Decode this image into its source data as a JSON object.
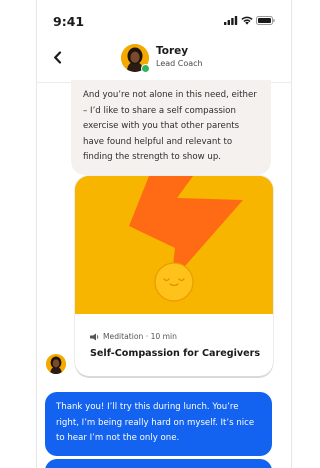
{
  "status_bar": {
    "time": "9:41"
  },
  "header": {
    "coach_name": "Torey",
    "coach_role": "Lead Coach"
  },
  "messages": {
    "incoming_text": "And you’re not alone in this need, either – I’d like to share a self compassion exercise with you that other parents have found helpful and relevant to finding the strength to show up.",
    "outgoing_text": "Thank you! I’ll try this during lunch. You’re right, I’m being really hard on myself. It’s nice to hear I’m not the only one."
  },
  "card": {
    "meta": "Meditation · 10 min",
    "title": "Self-Compassion for Caregivers",
    "meta_icon": "audio-waves-icon"
  },
  "colors": {
    "accent_blue": "#1463f0",
    "card_yellow": "#f7b500",
    "bolt_orange": "#ff6a14",
    "bubble_gray": "#f4f1ef"
  }
}
